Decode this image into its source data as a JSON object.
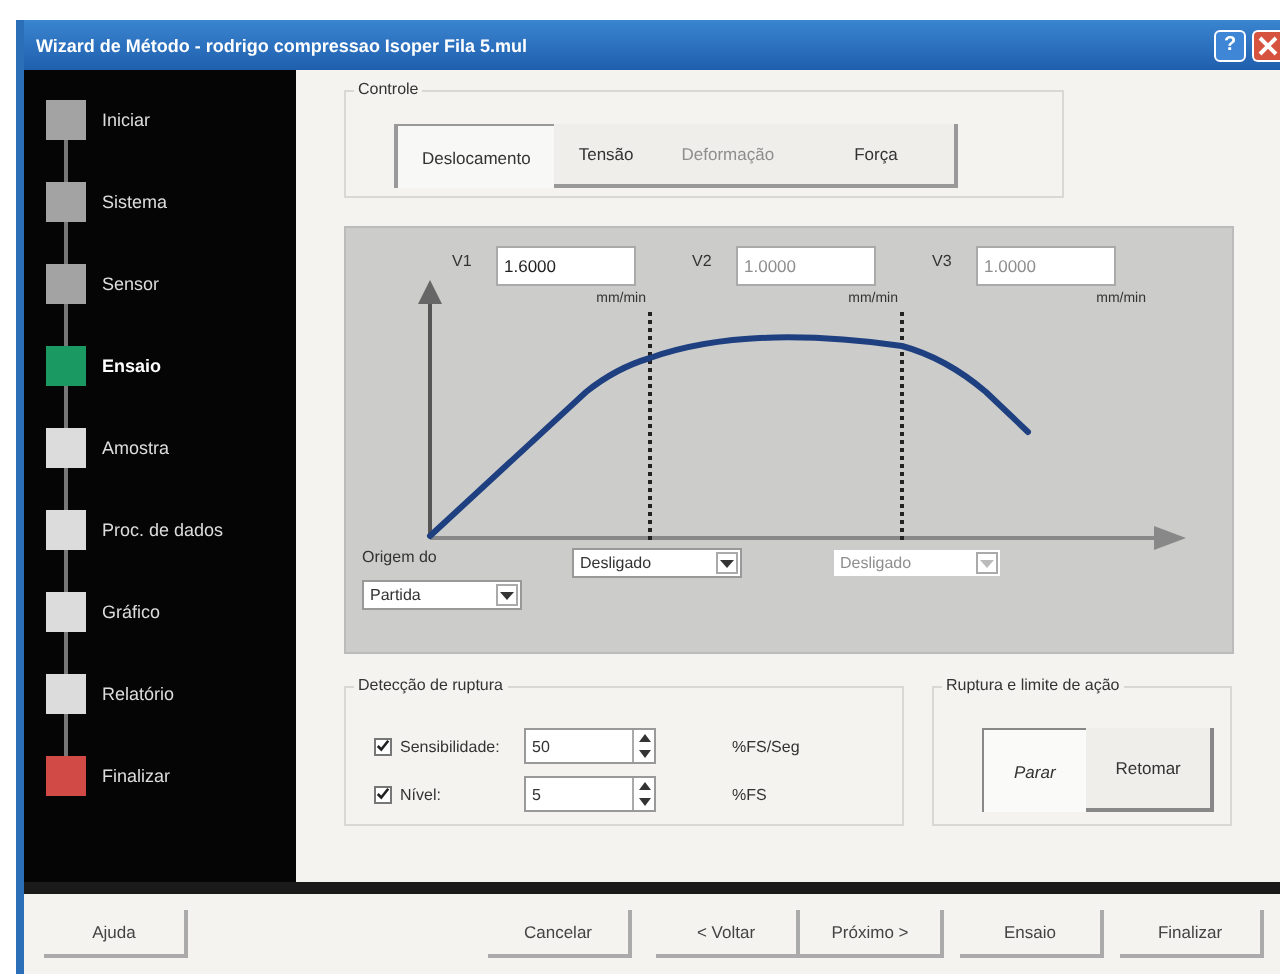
{
  "window": {
    "title": "Wizard de Método - rodrigo compressao Isoper Fila 5.mul",
    "help": "?"
  },
  "steps": [
    {
      "label": "Iniciar",
      "color": "#a3a3a3",
      "selected": false
    },
    {
      "label": "Sistema",
      "color": "#a3a3a3",
      "selected": false
    },
    {
      "label": "Sensor",
      "color": "#a3a3a3",
      "selected": false
    },
    {
      "label": "Ensaio",
      "color": "#1a9a62",
      "selected": true
    },
    {
      "label": "Amostra",
      "color": "#dcdcdc",
      "selected": false
    },
    {
      "label": "Proc. de dados",
      "color": "#dcdcdc",
      "selected": false
    },
    {
      "label": "Gráfico",
      "color": "#dcdcdc",
      "selected": false
    },
    {
      "label": "Relatório",
      "color": "#dcdcdc",
      "selected": false
    },
    {
      "label": "Finalizar",
      "color": "#d24a45",
      "selected": false
    }
  ],
  "controle": {
    "title": "Controle",
    "tabs": [
      {
        "label": "Deslocamento",
        "selected": true,
        "disabled": false
      },
      {
        "label": "Tensão",
        "selected": false,
        "disabled": false
      },
      {
        "label": "Deformação",
        "selected": false,
        "disabled": true
      },
      {
        "label": "Força",
        "selected": false,
        "disabled": false
      }
    ]
  },
  "velocities": [
    {
      "label": "V1",
      "value": "1.6000",
      "unit": "mm/min",
      "disabled": false
    },
    {
      "label": "V2",
      "value": "1.0000",
      "unit": "mm/min",
      "disabled": true
    },
    {
      "label": "V3",
      "value": "1.0000",
      "unit": "mm/min",
      "disabled": true
    }
  ],
  "origin": {
    "label": "Origem do",
    "value": "Partida"
  },
  "switches": [
    {
      "value": "Desligado",
      "disabled": false
    },
    {
      "value": "Desligado",
      "disabled": true
    }
  ],
  "rupture_detection": {
    "title": "Detecção de ruptura",
    "rows": [
      {
        "label": "Sensibilidade:",
        "checked": true,
        "value": "50",
        "unit": "%FS/Seg"
      },
      {
        "label": "Nível:",
        "checked": true,
        "value": "5",
        "unit": "%FS"
      }
    ]
  },
  "rupture_action": {
    "title": "Ruptura e limite de ação",
    "options": [
      {
        "label": "Parar",
        "selected": true
      },
      {
        "label": "Retomar",
        "selected": false
      }
    ]
  },
  "buttons": [
    "Ajuda",
    "Cancelar",
    "< Voltar",
    "Próximo >",
    "Ensaio",
    "Finalizar"
  ]
}
